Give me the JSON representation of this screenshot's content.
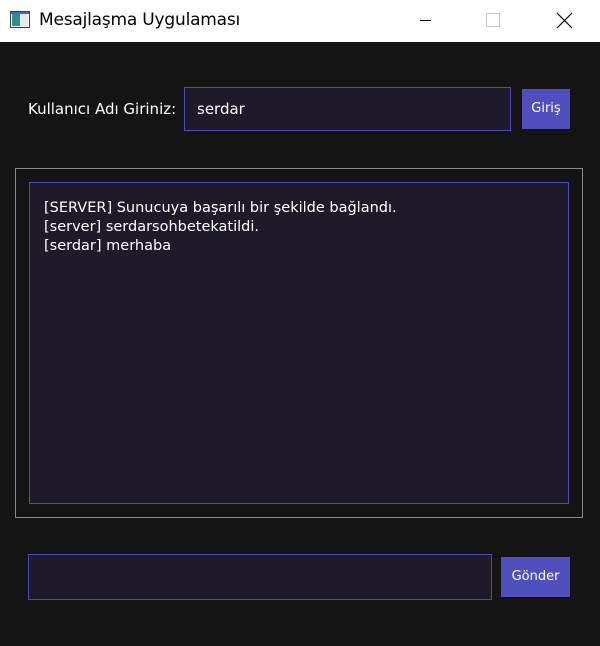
{
  "window": {
    "title": "Mesajlaşma Uygulaması",
    "app_icon": "app-window-icon",
    "controls": [
      "minimize-icon",
      "maximize-icon",
      "close-icon"
    ]
  },
  "login": {
    "label": "Kullanıcı Adı Giriniz:",
    "username_value": "serdar",
    "button_label": "Giriş"
  },
  "chat": {
    "lines": [
      "[SERVER] Sunucuya başarılı bir şekilde bağlandı.",
      "[server] serdarsohbetekatildi.",
      "[serdar] merhaba"
    ]
  },
  "composer": {
    "message_value": "",
    "send_label": "Gönder"
  },
  "colors": {
    "background": "#141414",
    "field_bg": "#1e1a29",
    "field_border": "#4b4cba",
    "button_bg": "#4f4fbd",
    "text": "#ffffff"
  }
}
